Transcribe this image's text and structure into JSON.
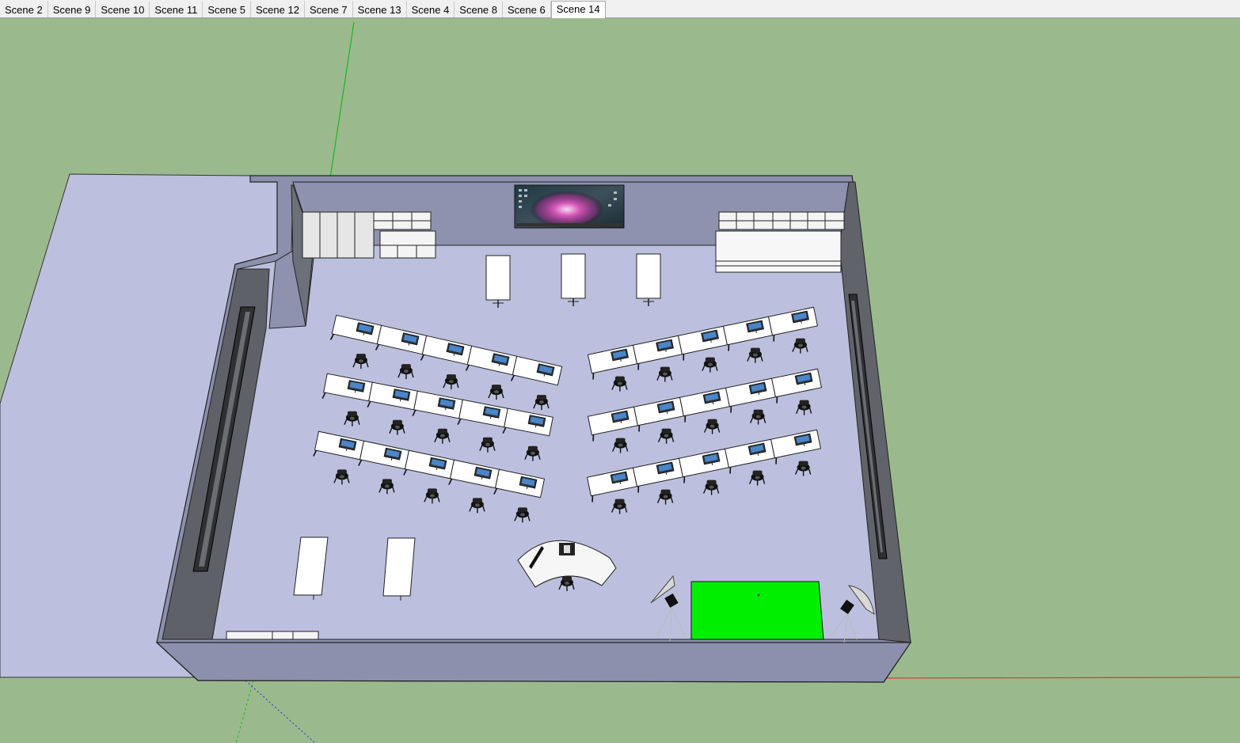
{
  "scene_tabs": [
    {
      "label": "Scene 2",
      "active": false
    },
    {
      "label": "Scene 9",
      "active": false
    },
    {
      "label": "Scene 10",
      "active": false
    },
    {
      "label": "Scene 11",
      "active": false
    },
    {
      "label": "Scene 5",
      "active": false
    },
    {
      "label": "Scene 12",
      "active": false
    },
    {
      "label": "Scene 7",
      "active": false
    },
    {
      "label": "Scene 13",
      "active": false
    },
    {
      "label": "Scene 4",
      "active": false
    },
    {
      "label": "Scene 8",
      "active": false
    },
    {
      "label": "Scene 6",
      "active": false
    },
    {
      "label": "Scene 14",
      "active": true
    }
  ],
  "colors": {
    "ground": "#9aba8e",
    "floor": "#bcc0de",
    "wall_top": "#8c90ac",
    "wall_dark": "#55585e",
    "green_screen": "#00ee00",
    "axis_red": "#d23c3c",
    "axis_green": "#1fb31f",
    "axis_blue": "#2a2acc"
  },
  "icons": {
    "wall_screen": "desktop-wallpaper-screen",
    "monitor": "monitor-icon",
    "chair": "office-chair-icon",
    "light": "studio-light-icon"
  }
}
